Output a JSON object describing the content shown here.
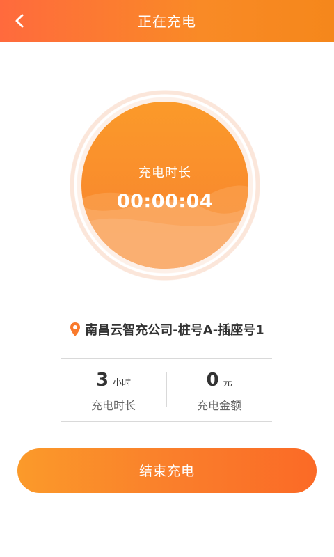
{
  "header": {
    "title": "正在充电",
    "back_icon": "chevron-left-icon"
  },
  "gauge": {
    "label": "充电时长",
    "elapsed_time": "00:00:04"
  },
  "station": {
    "location_icon": "map-pin-icon",
    "name": "南昌云智充公司-桩号A-插座号1"
  },
  "stats": {
    "duration": {
      "value": "3",
      "unit": "小时",
      "label": "充电时长"
    },
    "amount": {
      "value": "0",
      "unit": "元",
      "label": "充电金额"
    }
  },
  "actions": {
    "end_label": "结束充电"
  },
  "colors": {
    "accent": "#F98A26",
    "accent_red": "#FF6A3D",
    "text_dark": "#333333",
    "text_muted": "#666666"
  }
}
